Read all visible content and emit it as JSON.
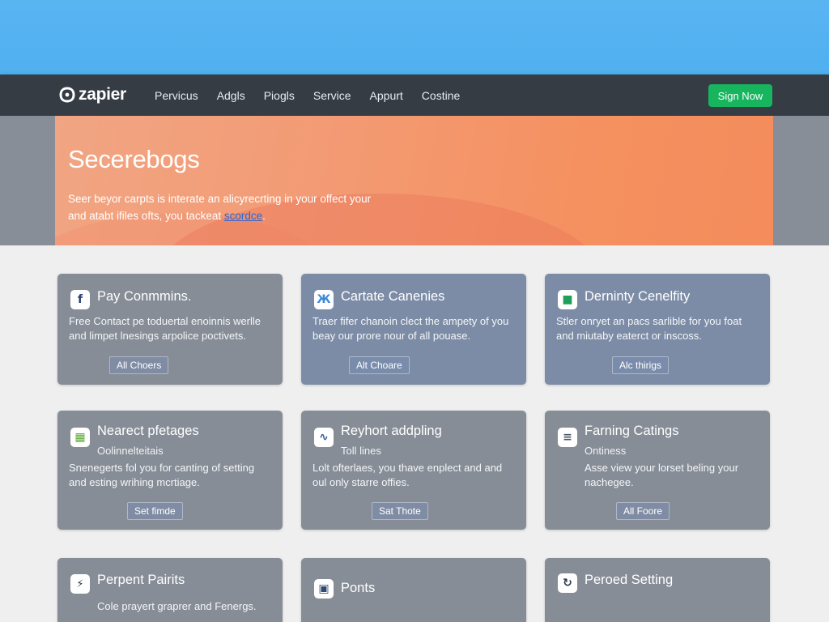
{
  "nav": {
    "logo_text": "zapier",
    "links": [
      "Pervicus",
      "Adgls",
      "Piogls",
      "Service",
      "Appurt",
      "Costine"
    ],
    "signup_label": "Sign Now"
  },
  "hero": {
    "title": "Secerebogs",
    "desc_line1": "Seer beyor carpts is interate an alicyrecrting in your offect your",
    "desc_line2": "and atabt ifiles ofts, you tackeat",
    "link_text": "scordce",
    "desc_end": "."
  },
  "cards": [
    {
      "icon": "facebook-icon",
      "icon_glyph": "f",
      "icon_color": "#2c3e73",
      "title": "Pay Conmmins.",
      "subtitle": "",
      "desc": "Free Contact pe toduertal enoinnis werlle and limpet lnesings arpolice poctivets.",
      "button": "All Choers"
    },
    {
      "icon": "bird-icon",
      "icon_glyph": "Ж",
      "icon_color": "#3a8ad8",
      "title": "Cartate Canenies",
      "subtitle": "",
      "desc": "Traer fifer chanoin clect the ampety of you beay our prore nour of all pouase.",
      "button": "Alt Choare"
    },
    {
      "icon": "green-square-icon",
      "icon_glyph": "■",
      "icon_color": "#1ea05a",
      "title": "Derninty Cenelfity",
      "subtitle": "",
      "desc": "Stler onryet an pacs sarlible for you foat and miutaby eaterct or inscoss.",
      "button": "Alc thirigs"
    },
    {
      "icon": "grid-icon",
      "icon_glyph": "▦",
      "icon_color": "#5aa534",
      "title": "Nearect pfetages",
      "subtitle": "Oolinnelteitais",
      "desc": "Snenegerts fol you for canting of setting and esting wrihing mcrtiage.",
      "button": "Set fimde"
    },
    {
      "icon": "wave-icon",
      "icon_glyph": "∿",
      "icon_color": "#3a5f9e",
      "title": "Reyhort addpling",
      "subtitle": "Toll lines",
      "desc": "Lolt ofterlaes, you thave enplect and and oul only starre offies.",
      "button": "Sat Thote"
    },
    {
      "icon": "list-icon",
      "icon_glyph": "≡",
      "icon_color": "#4a5566",
      "title": "Farning Catings",
      "subtitle": "Ontiness",
      "desc": "Asse view your lorset beling your nachegee.",
      "button": "All Foore"
    },
    {
      "icon": "bolt-icon",
      "icon_glyph": "⚡",
      "icon_color": "#2f3a4a",
      "title": "Perpent Pairits",
      "subtitle": "",
      "desc": "Cole prayert graprer and Fenergs.",
      "button": ""
    },
    {
      "icon": "user-icon",
      "icon_glyph": "▣",
      "icon_color": "#2f4a6e",
      "title": "Ponts",
      "subtitle": "",
      "desc": "",
      "button": ""
    },
    {
      "icon": "refresh-icon",
      "icon_glyph": "↻",
      "icon_color": "#2f3a4a",
      "title": "Peroed Setting",
      "subtitle": "",
      "desc": "",
      "button": ""
    }
  ]
}
